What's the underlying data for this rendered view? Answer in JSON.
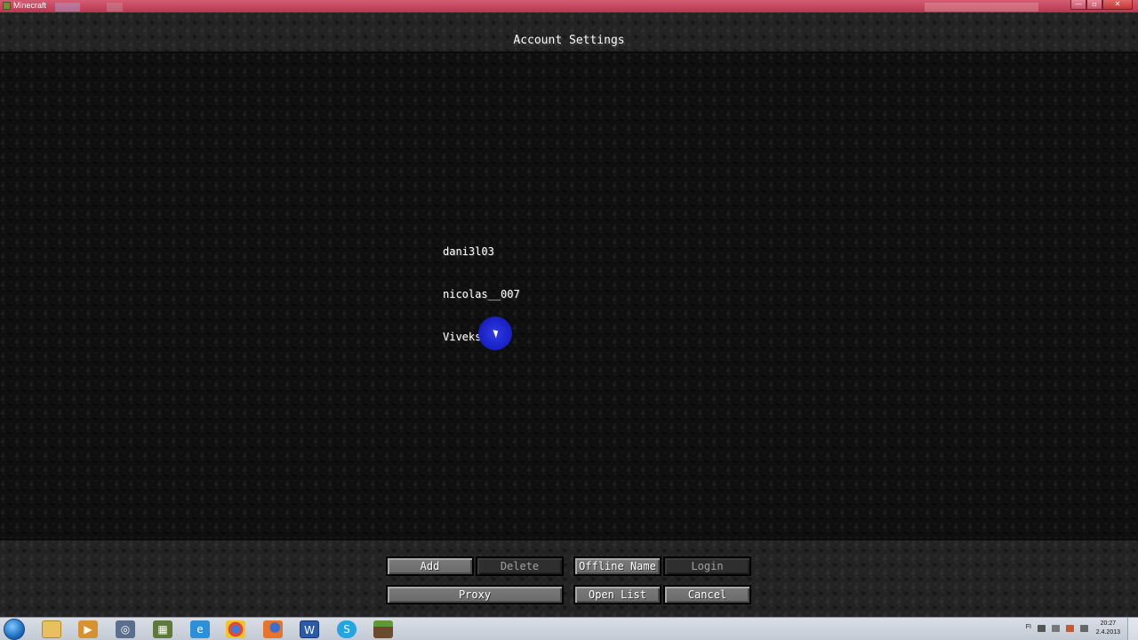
{
  "window": {
    "title": "Minecraft",
    "controls": {
      "minimize": "—",
      "maximize": "▫",
      "close": "✕"
    }
  },
  "header": {
    "title": "Account Settings"
  },
  "accounts": [
    {
      "name": "dani3l03"
    },
    {
      "name": "nicolas__007"
    },
    {
      "name": "Viveksooo"
    }
  ],
  "buttons": {
    "add": "Add",
    "delete": "Delete",
    "offline_name": "Offline Name",
    "login": "Login",
    "proxy": "Proxy",
    "open_list": "Open List",
    "cancel": "Cancel"
  },
  "taskbar": {
    "icons": [
      "explorer-folder-icon",
      "media-player-icon",
      "chrome-like-icon",
      "minecraft-tool-icon",
      "internet-explorer-icon",
      "chrome-icon",
      "firefox-icon",
      "word-icon",
      "skype-icon",
      "minecraft-icon"
    ],
    "language": "FI",
    "time": "20:27",
    "date": "2.4.2013"
  },
  "colors": {
    "titlebar": "#c8465f",
    "background": "#0f0f0f",
    "button": "#707070",
    "button_disabled": "#2e2e2e",
    "cursor_highlight": "#2f3ce0"
  }
}
